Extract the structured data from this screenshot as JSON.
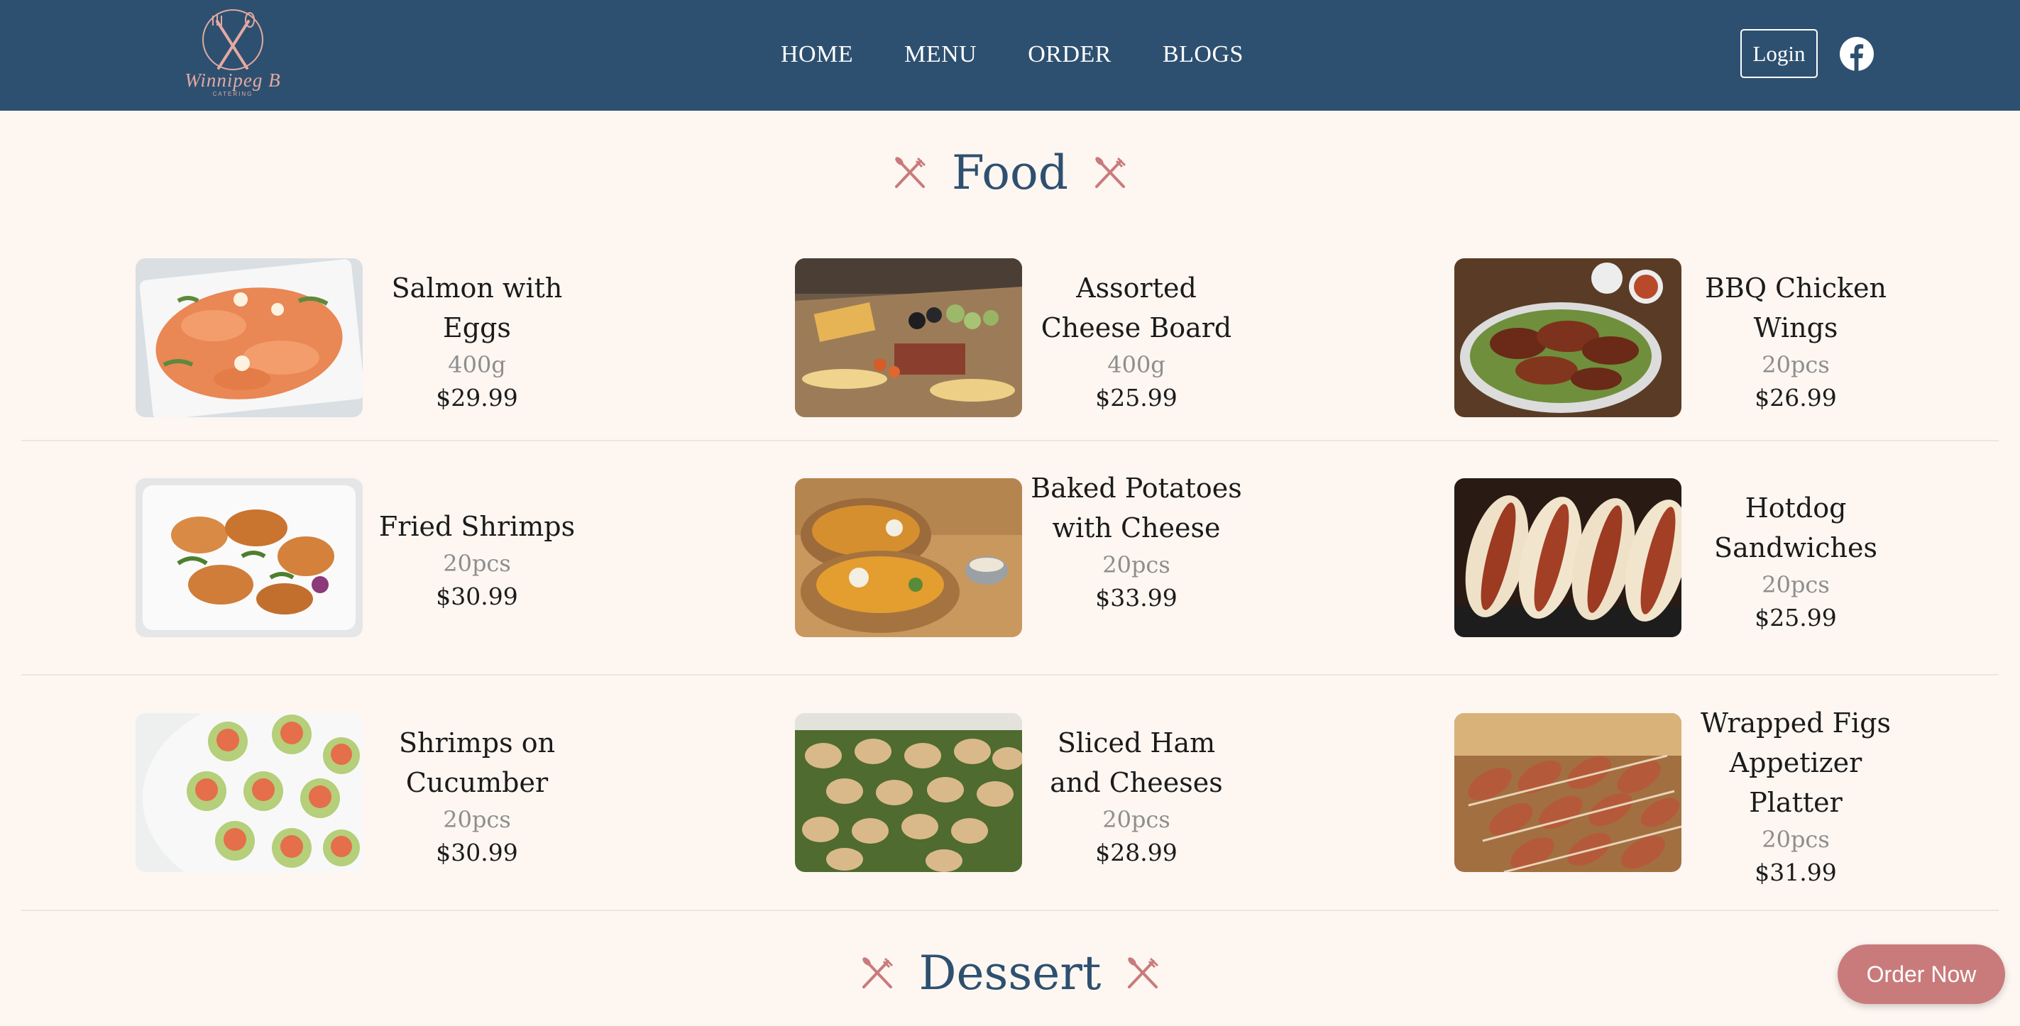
{
  "header": {
    "logo": {
      "text": "Winnipeg B",
      "subtext": "CATERING"
    },
    "nav": [
      {
        "label": "HOME"
      },
      {
        "label": "MENU"
      },
      {
        "label": "ORDER"
      },
      {
        "label": "BLOGS"
      }
    ],
    "login_label": "Login",
    "social_icon": "facebook-icon"
  },
  "sections": {
    "food": {
      "title": "Food",
      "icon": "cutlery-icon"
    },
    "dessert": {
      "title": "Dessert",
      "icon": "cutlery-icon"
    }
  },
  "food_items": [
    {
      "name": "Salmon with Eggs",
      "qty": "400g",
      "price": "$29.99",
      "photo": "salmon-photo"
    },
    {
      "name": "Assorted Cheese Board",
      "qty": "400g",
      "price": "$25.99",
      "photo": "cheese-board-photo"
    },
    {
      "name": "BBQ Chicken Wings",
      "qty": "20pcs",
      "price": "$26.99",
      "photo": "chicken-wings-photo"
    },
    {
      "name": "Fried Shrimps",
      "qty": "20pcs",
      "price": "$30.99",
      "photo": "fried-shrimps-photo"
    },
    {
      "name": "Baked Potatoes with Cheese",
      "qty": "20pcs",
      "price": "$33.99",
      "photo": "baked-potatoes-photo"
    },
    {
      "name": "Hotdog Sandwiches",
      "qty": "20pcs",
      "price": "$25.99",
      "photo": "hotdog-photo"
    },
    {
      "name": "Shrimps on Cucumber",
      "qty": "20pcs",
      "price": "$30.99",
      "photo": "shrimps-cucumber-photo"
    },
    {
      "name": "Sliced Ham and Cheeses",
      "qty": "20pcs",
      "price": "$28.99",
      "photo": "ham-cheese-photo"
    },
    {
      "name": "Wrapped Figs Appetizer Platter",
      "qty": "20pcs",
      "price": "$31.99",
      "photo": "wrapped-figs-photo"
    }
  ],
  "order_button_label": "Order Now",
  "colors": {
    "header_bg": "#2e5070",
    "page_bg": "#fdf6f1",
    "accent": "#c97b7b",
    "heading": "#2e5070",
    "muted": "#8e8e8e"
  }
}
